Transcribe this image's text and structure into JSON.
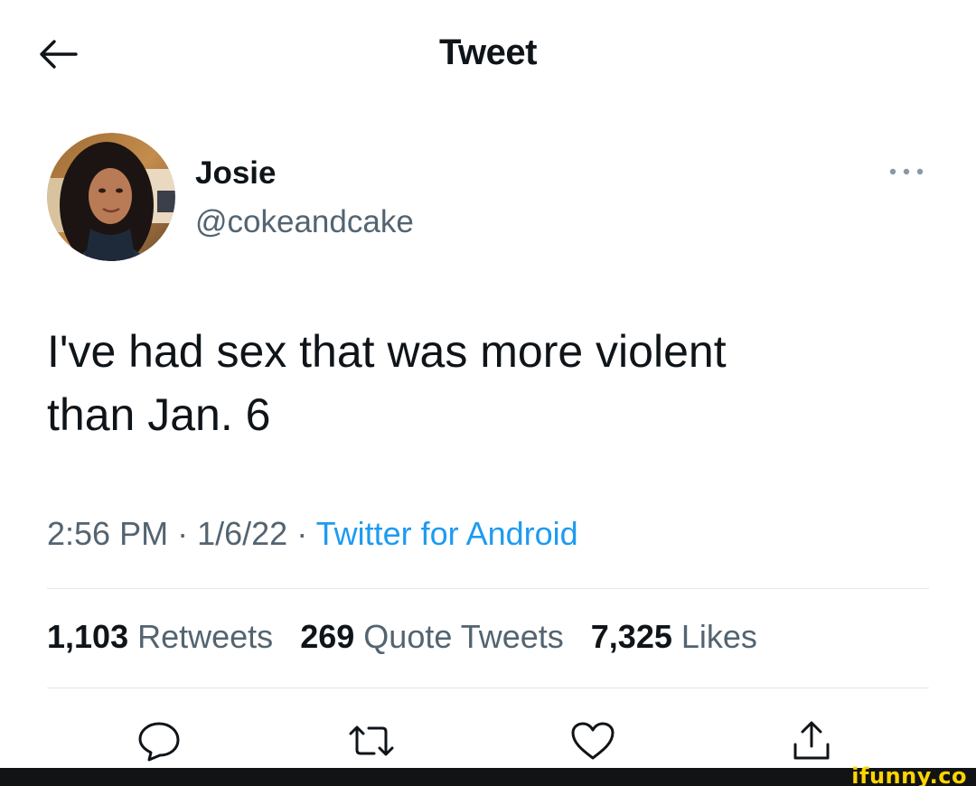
{
  "header": {
    "title": "Tweet",
    "back_icon": "arrow-left-icon"
  },
  "author": {
    "name": "Josie",
    "handle": "@cokeandcake",
    "avatar_icon": "avatar-photo",
    "more_icon": "more-horizontal-icon"
  },
  "tweet": {
    "line1": "I've had sex that was more violent",
    "line2": "than Jan. 6"
  },
  "meta": {
    "time": "2:56 PM",
    "separator": "·",
    "date": "1/6/22",
    "source": "Twitter for Android"
  },
  "stats": {
    "retweets_count": "1,103",
    "retweets_label": "Retweets",
    "quotes_count": "269",
    "quotes_label": "Quote Tweets",
    "likes_count": "7,325",
    "likes_label": "Likes"
  },
  "actions": {
    "reply_icon": "reply-icon",
    "retweet_icon": "retweet-icon",
    "like_icon": "heart-icon",
    "share_icon": "share-icon"
  },
  "watermark": {
    "text": "ifunny.co"
  },
  "colors": {
    "text_primary": "#0f1419",
    "text_secondary": "#536471",
    "accent": "#1d9bf0",
    "divider": "#e3e6e8",
    "watermark": "#ffd400"
  }
}
